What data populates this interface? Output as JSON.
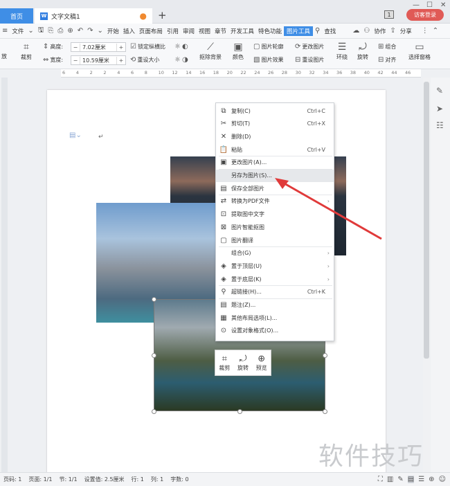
{
  "tabs": {
    "home": "首页",
    "doc": "文字文稿1",
    "badge": "1",
    "login": "访客登录"
  },
  "menu": {
    "file": "文件",
    "items": [
      "开始",
      "插入",
      "页面布局",
      "引用",
      "审阅",
      "视图",
      "章节",
      "开发工具",
      "特色功能"
    ],
    "active": "图片工具",
    "search": "查找",
    "collab": "协作",
    "share": "分享"
  },
  "ribbon": {
    "crop": "裁剪",
    "height_label": "高度:",
    "height_value": "7.02厘米",
    "width_label": "宽度:",
    "width_value": "10.59厘米",
    "lock_ratio": "锁定纵横比",
    "reset_size": "重设大小",
    "remove_bg": "抠除背景",
    "color": "颜色",
    "outline": "图片轮廓",
    "effect": "图片效果",
    "change": "更改图片",
    "reset_pic": "重设图片",
    "wrap": "环绕",
    "rotate": "旋转",
    "group": "组合",
    "align": "对齐",
    "select_pane": "选择窗格",
    "left_cut": "放"
  },
  "ruler": [
    "6",
    "4",
    "2",
    "2",
    "4",
    "6",
    "8",
    "10",
    "12",
    "14",
    "16",
    "18",
    "20",
    "22",
    "24",
    "26",
    "28",
    "30",
    "32",
    "34",
    "36",
    "38",
    "40",
    "42",
    "44",
    "46"
  ],
  "context_menu": [
    {
      "icon": "copy-icon",
      "glyph": "⧉",
      "label": "复制(C)",
      "shortcut": "Ctrl+C"
    },
    {
      "icon": "cut-icon",
      "glyph": "✂",
      "label": "剪切(T)",
      "shortcut": "Ctrl+X"
    },
    {
      "icon": "delete-icon",
      "glyph": "✕",
      "label": "删除(D)",
      "shortcut": ""
    },
    {
      "icon": "paste-icon",
      "glyph": "📋",
      "label": "粘贴",
      "shortcut": "Ctrl+V"
    },
    {
      "icon": "change-picture-icon",
      "glyph": "▣",
      "label": "更改图片(A)...",
      "shortcut": ""
    },
    {
      "icon": "save-as-icon",
      "glyph": "",
      "label": "另存为图片(S)...",
      "shortcut": ""
    },
    {
      "icon": "save-all-icon",
      "glyph": "▤",
      "label": "保存全部图片",
      "shortcut": ""
    },
    {
      "icon": "pdf-icon",
      "glyph": "⇄",
      "label": "转换为PDF文件",
      "shortcut": ""
    },
    {
      "icon": "extract-text-icon",
      "glyph": "⊡",
      "label": "提取图中文字",
      "shortcut": ""
    },
    {
      "icon": "smart-cutout-icon",
      "glyph": "⊠",
      "label": "图片智能抠图",
      "shortcut": ""
    },
    {
      "icon": "translate-icon",
      "glyph": "▢",
      "label": "图片翻译",
      "shortcut": ""
    },
    {
      "icon": "group-icon",
      "glyph": "",
      "label": "组合(G)",
      "shortcut": ""
    },
    {
      "icon": "bring-front-icon",
      "glyph": "◈",
      "label": "置于顶层(U)",
      "shortcut": ""
    },
    {
      "icon": "send-back-icon",
      "glyph": "◈",
      "label": "置于底层(K)",
      "shortcut": ""
    },
    {
      "icon": "hyperlink-icon",
      "glyph": "⚲",
      "label": "超链接(H)...",
      "shortcut": "Ctrl+K"
    },
    {
      "icon": "caption-icon",
      "glyph": "▤",
      "label": "题注(Z)...",
      "shortcut": ""
    },
    {
      "icon": "layout-options-icon",
      "glyph": "▦",
      "label": "其他布局选项(L)...",
      "shortcut": ""
    },
    {
      "icon": "format-object-icon",
      "glyph": "⊙",
      "label": "设置对象格式(O)...",
      "shortcut": ""
    }
  ],
  "mini": {
    "crop": "裁剪",
    "rotate": "旋转",
    "preview": "预览"
  },
  "status": {
    "page_num": "页码: 1",
    "pages": "页面: 1/1",
    "section": "节: 1/1",
    "setting": "设置值: 2.5厘米",
    "row": "行: 1",
    "col": "列: 1",
    "chars": "字数: 0"
  },
  "watermark": "软件技巧"
}
